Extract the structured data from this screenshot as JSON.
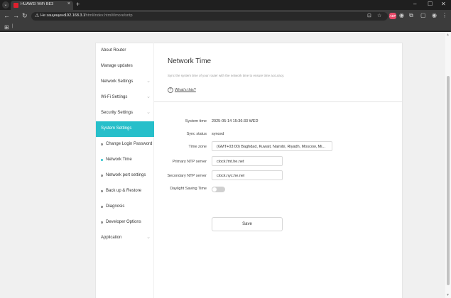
{
  "browser": {
    "tab_title": "HUAWEI WiFi BE3",
    "security_text": "Не защищено",
    "url_host": "192.168.3.1",
    "url_path": "/html/index.html#/more/sntp"
  },
  "icons": {
    "tab_menu": "⌄",
    "close": "×",
    "new_tab": "+",
    "minimize": "–",
    "maximize": "☐",
    "window_close": "✕",
    "back": "←",
    "forward": "→",
    "reload": "↻",
    "warning": "⚠",
    "translate": "⊡",
    "star": "☆",
    "profile": "◉",
    "puzzle": "⧉",
    "split": "▢",
    "menu": "⋮",
    "apps": "⊞",
    "chevron_down": "⌄",
    "help": "?",
    "scroll_up": "▲",
    "scroll_down": "▼"
  },
  "ext_badge": "ABP",
  "sidebar": {
    "items": [
      {
        "label": "About Router"
      },
      {
        "label": "Manage updates"
      },
      {
        "label": "Network Settings"
      },
      {
        "label": "Wi-Fi Settings"
      },
      {
        "label": "Security Settings"
      },
      {
        "label": "System Settings"
      },
      {
        "label": "Change Login Password"
      },
      {
        "label": "Network Time"
      },
      {
        "label": "Network port settings"
      },
      {
        "label": "Back up & Restore"
      },
      {
        "label": "Diagnosis"
      },
      {
        "label": "Developer Options"
      },
      {
        "label": "Application"
      }
    ]
  },
  "main": {
    "title": "Network Time",
    "description": "Sync the system time of your router with the network time to ensure time accuracy.",
    "help_link": "What's this?",
    "fields": {
      "system_time_label": "System time",
      "system_time_value": "2025-05-14 15:36:33 WED",
      "sync_status_label": "Sync status",
      "sync_status_value": "synced",
      "time_zone_label": "Time zone",
      "time_zone_value": "(GMT+03:00) Baghdad, Kuwait, Nairobi, Riyadh, Moscow, Mi...",
      "primary_ntp_label": "Primary NTP server",
      "primary_ntp_value": "clock.fmt.he.net",
      "secondary_ntp_label": "Secondary NTP server",
      "secondary_ntp_value": "clock.nyc.he.net",
      "dst_label": "Daylight Saving Time",
      "dst_enabled": false
    },
    "save_label": "Save"
  },
  "colors": {
    "accent": "#27bfca"
  }
}
